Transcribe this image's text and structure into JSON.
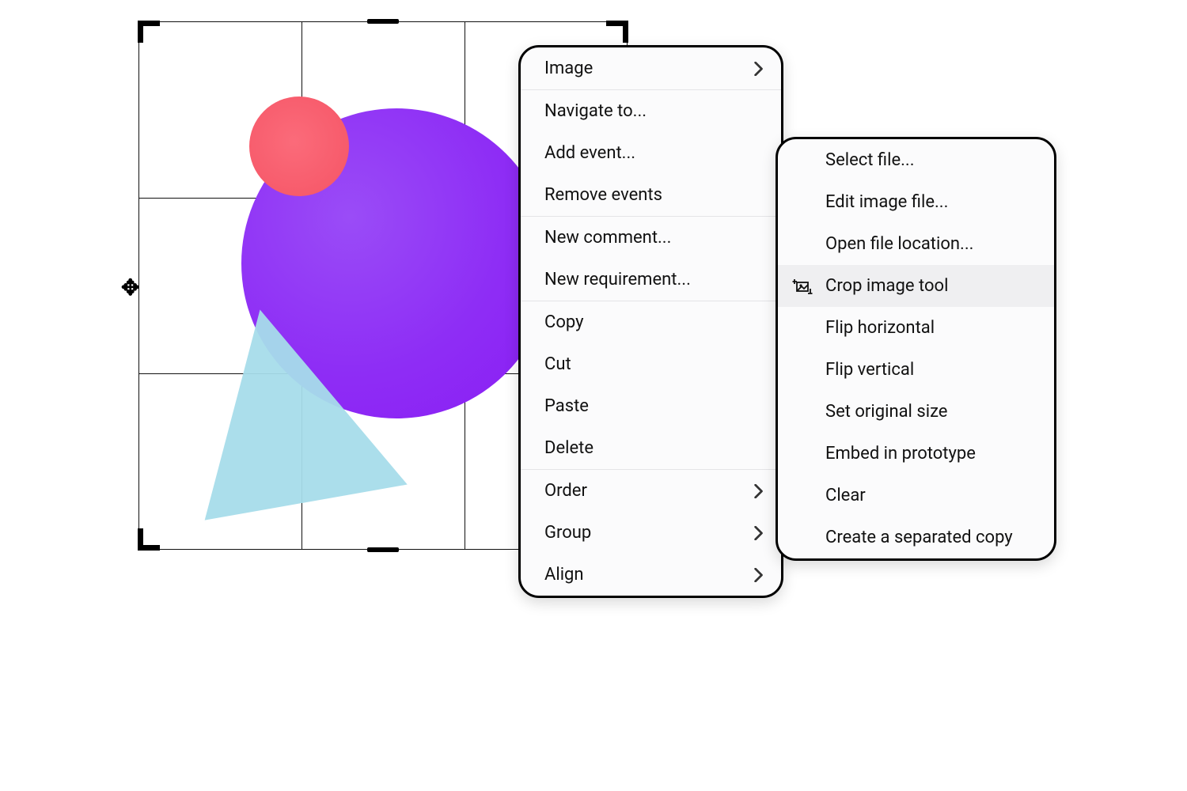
{
  "menu_primary": {
    "sections": [
      {
        "items": [
          {
            "label": "Image",
            "submenu": true
          }
        ]
      },
      {
        "items": [
          {
            "label": "Navigate to..."
          },
          {
            "label": "Add event..."
          },
          {
            "label": "Remove events"
          }
        ]
      },
      {
        "items": [
          {
            "label": "New comment..."
          },
          {
            "label": "New requirement..."
          }
        ]
      },
      {
        "items": [
          {
            "label": "Copy"
          },
          {
            "label": "Cut"
          },
          {
            "label": "Paste"
          },
          {
            "label": "Delete"
          }
        ]
      },
      {
        "items": [
          {
            "label": "Order",
            "submenu": true
          },
          {
            "label": "Group",
            "submenu": true
          },
          {
            "label": "Align",
            "submenu": true
          }
        ]
      }
    ]
  },
  "menu_secondary": {
    "items": [
      {
        "label": "Select file..."
      },
      {
        "label": "Edit image file..."
      },
      {
        "label": "Open file location..."
      },
      {
        "label": "Crop image tool",
        "highlighted": true,
        "icon": "crop-image-icon"
      },
      {
        "label": "Flip horizontal"
      },
      {
        "label": "Flip vertical"
      },
      {
        "label": "Set original size"
      },
      {
        "label": "Embed in prototype"
      },
      {
        "label": "Clear"
      },
      {
        "label": "Create a separated copy"
      }
    ]
  },
  "colors": {
    "big_circle": "#8e2df5",
    "small_circle": "#f55465",
    "triangle": "#a7dcea",
    "menu_bg": "#fbfbfc",
    "menu_border": "#000000",
    "hover_bg": "#efeff1"
  }
}
